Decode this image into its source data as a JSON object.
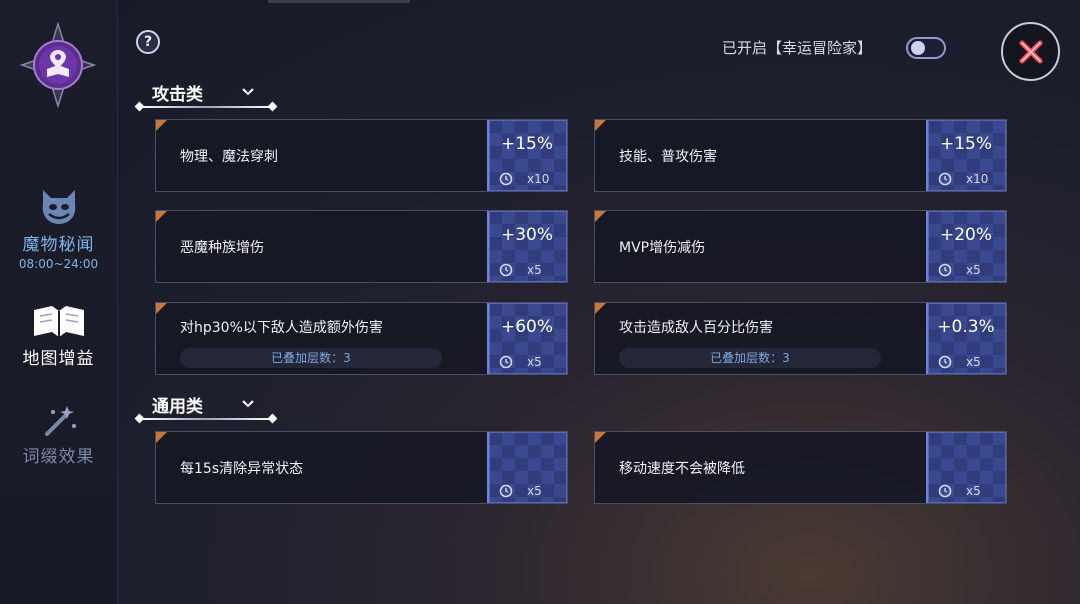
{
  "sidebar": {
    "items": [
      {
        "label": "魔物秘闻",
        "sub": "08:00~24:00",
        "icon": "demon-face-icon",
        "color": "#7fb4e8"
      },
      {
        "label": "地图增益",
        "icon": "map-book-icon",
        "color": "#ffffff"
      },
      {
        "label": "词缀效果",
        "icon": "magic-wand-icon",
        "color": "#7d87a8"
      }
    ]
  },
  "header": {
    "help_label": "?",
    "toggle_label": "已开启【幸运冒险家】",
    "toggle_on": false
  },
  "sections": [
    {
      "title": "攻击类"
    },
    {
      "title": "通用类"
    }
  ],
  "cards": [
    {
      "name": "物理、魔法穿刺",
      "value": "+15%",
      "count": "x10"
    },
    {
      "name": "技能、普攻伤害",
      "value": "+15%",
      "count": "x10"
    },
    {
      "name": "恶魔种族增伤",
      "value": "+30%",
      "count": "x5"
    },
    {
      "name": "MVP增伤减伤",
      "value": "+20%",
      "count": "x5"
    },
    {
      "name": "对hp30%以下敌人造成额外伤害",
      "value": "+60%",
      "count": "x5",
      "stack": "已叠加层数：3"
    },
    {
      "name": "攻击造成敌人百分比伤害",
      "value": "+0.3%",
      "count": "x5",
      "stack": "已叠加层数：3"
    },
    {
      "name": "每15s清除异常状态",
      "value": "",
      "count": "x5"
    },
    {
      "name": "移动速度不会被降低",
      "value": "",
      "count": "x5"
    }
  ],
  "colors": {
    "accent": "#3a4890",
    "corner": "#c8773a",
    "active_nav": "#ffffff",
    "inactive_nav": "#7d87a8"
  }
}
